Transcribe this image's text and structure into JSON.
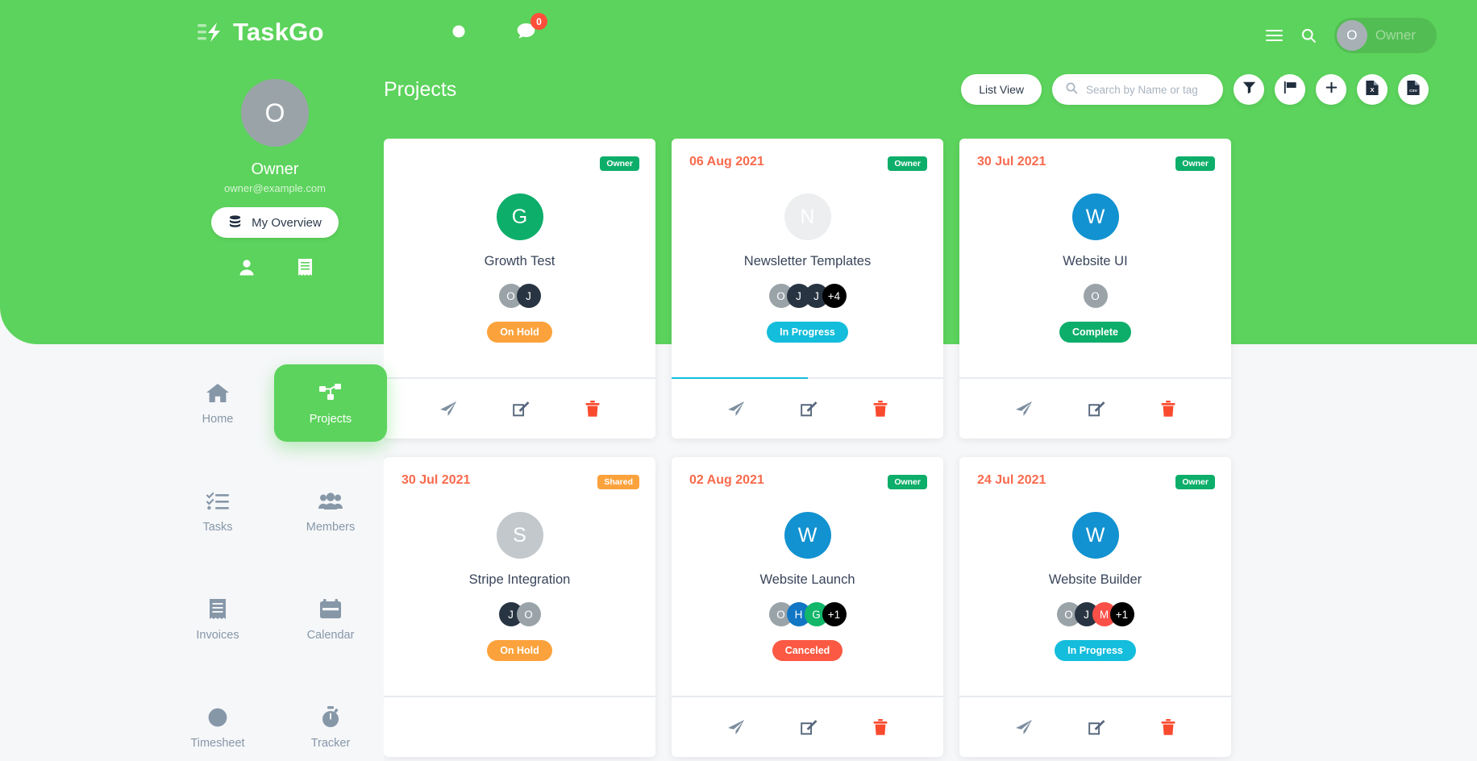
{
  "brand": {
    "name": "TaskGo"
  },
  "topbar": {
    "clock_icon": "clock-icon",
    "chat_icon": "chat-icon",
    "chat_count": "0",
    "menu_icon": "hamburger-menu-icon",
    "search_icon": "search-icon",
    "user_initial": "O",
    "user_name": "Owner"
  },
  "profile": {
    "initial": "O",
    "name": "Owner",
    "email": "owner@example.com",
    "overview_label": "My Overview",
    "icons": [
      "person-icon",
      "receipt-icon"
    ]
  },
  "nav": {
    "items": [
      {
        "label": "Home",
        "icon": "home-icon",
        "active": false
      },
      {
        "label": "Projects",
        "icon": "sitemap-icon",
        "active": true
      },
      {
        "label": "Tasks",
        "icon": "tasklist-icon",
        "active": false
      },
      {
        "label": "Members",
        "icon": "users-icon",
        "active": false
      },
      {
        "label": "Invoices",
        "icon": "receipt-icon",
        "active": false
      },
      {
        "label": "Calendar",
        "icon": "calendar-icon",
        "active": false
      },
      {
        "label": "Timesheet",
        "icon": "clock-icon",
        "active": false
      },
      {
        "label": "Tracker",
        "icon": "stopwatch-icon",
        "active": false
      }
    ]
  },
  "header": {
    "title": "Projects",
    "list_view_label": "List View",
    "search_placeholder": "Search by Name or tag",
    "search_value": "",
    "actions": [
      {
        "name": "filter-button",
        "icon": "funnel-icon"
      },
      {
        "name": "flag-button",
        "icon": "flag-icon"
      },
      {
        "name": "add-project-button",
        "icon": "plus-icon"
      },
      {
        "name": "export-excel-button",
        "icon": "file-excel-icon"
      },
      {
        "name": "export-csv-button",
        "icon": "file-csv-icon"
      }
    ]
  },
  "colors": {
    "brand_green": "#5cd35c",
    "date_red": "#f96a4d",
    "owner_tag": "#0dae6a",
    "shared_tag": "#fba23c",
    "in_progress": "#13bddb",
    "on_hold": "#fba23c",
    "complete": "#0dae6a",
    "canceled": "#fb5943"
  },
  "projects": [
    {
      "date": "",
      "tag": "Owner",
      "tag_type": "owner",
      "initial": "G",
      "avatar_color": "#0dae6a",
      "title": "Growth Test",
      "members": [
        {
          "label": "O",
          "color": "#9aa3a8"
        },
        {
          "label": "J",
          "color": "#283442"
        }
      ],
      "status": "On Hold",
      "status_type": "onhold",
      "progress": 0,
      "actions": [
        "send-icon",
        "edit-icon",
        "delete-icon"
      ]
    },
    {
      "date": "06 Aug 2021",
      "tag": "Owner",
      "tag_type": "owner",
      "initial": "N",
      "avatar_color": "#eceeef",
      "title": "Newsletter Templates",
      "members": [
        {
          "label": "O",
          "color": "#9aa3a8"
        },
        {
          "label": "J",
          "color": "#283442"
        },
        {
          "label": "J",
          "color": "#283442"
        },
        {
          "label": "+4",
          "color": "#000000"
        }
      ],
      "status": "In Progress",
      "status_type": "inprogress",
      "progress": 50,
      "actions": [
        "send-icon",
        "edit-icon",
        "delete-icon"
      ]
    },
    {
      "date": "30 Jul 2021",
      "tag": "Owner",
      "tag_type": "owner",
      "initial": "W",
      "avatar_color": "#1292d0",
      "title": "Website UI",
      "members": [
        {
          "label": "O",
          "color": "#9aa3a8"
        }
      ],
      "status": "Complete",
      "status_type": "complete",
      "progress": 0,
      "actions": [
        "send-icon",
        "edit-icon",
        "delete-icon"
      ]
    },
    {
      "date": "30 Jul 2021",
      "tag": "Shared",
      "tag_type": "shared",
      "initial": "S",
      "avatar_color": "#c2c8cc",
      "title": "Stripe Integration",
      "members": [
        {
          "label": "J",
          "color": "#283442"
        },
        {
          "label": "O",
          "color": "#9aa3a8"
        }
      ],
      "status": "On Hold",
      "status_type": "onhold",
      "progress": 0,
      "actions": []
    },
    {
      "date": "02 Aug 2021",
      "tag": "Owner",
      "tag_type": "owner",
      "initial": "W",
      "avatar_color": "#1292d0",
      "title": "Website Launch",
      "members": [
        {
          "label": "O",
          "color": "#9aa3a8"
        },
        {
          "label": "H",
          "color": "#1176c4"
        },
        {
          "label": "G",
          "color": "#12b76a"
        },
        {
          "label": "+1",
          "color": "#000000"
        }
      ],
      "status": "Canceled",
      "status_type": "canceled",
      "progress": 0,
      "actions": [
        "send-icon",
        "edit-icon",
        "delete-icon"
      ]
    },
    {
      "date": "24 Jul 2021",
      "tag": "Owner",
      "tag_type": "owner",
      "initial": "W",
      "avatar_color": "#1292d0",
      "title": "Website Builder",
      "members": [
        {
          "label": "O",
          "color": "#9aa3a8"
        },
        {
          "label": "J",
          "color": "#283442"
        },
        {
          "label": "M",
          "color": "#fb5048"
        },
        {
          "label": "+1",
          "color": "#000000"
        }
      ],
      "status": "In Progress",
      "status_type": "inprogress",
      "progress": 0,
      "actions": [
        "send-icon",
        "edit-icon",
        "delete-icon"
      ]
    }
  ]
}
